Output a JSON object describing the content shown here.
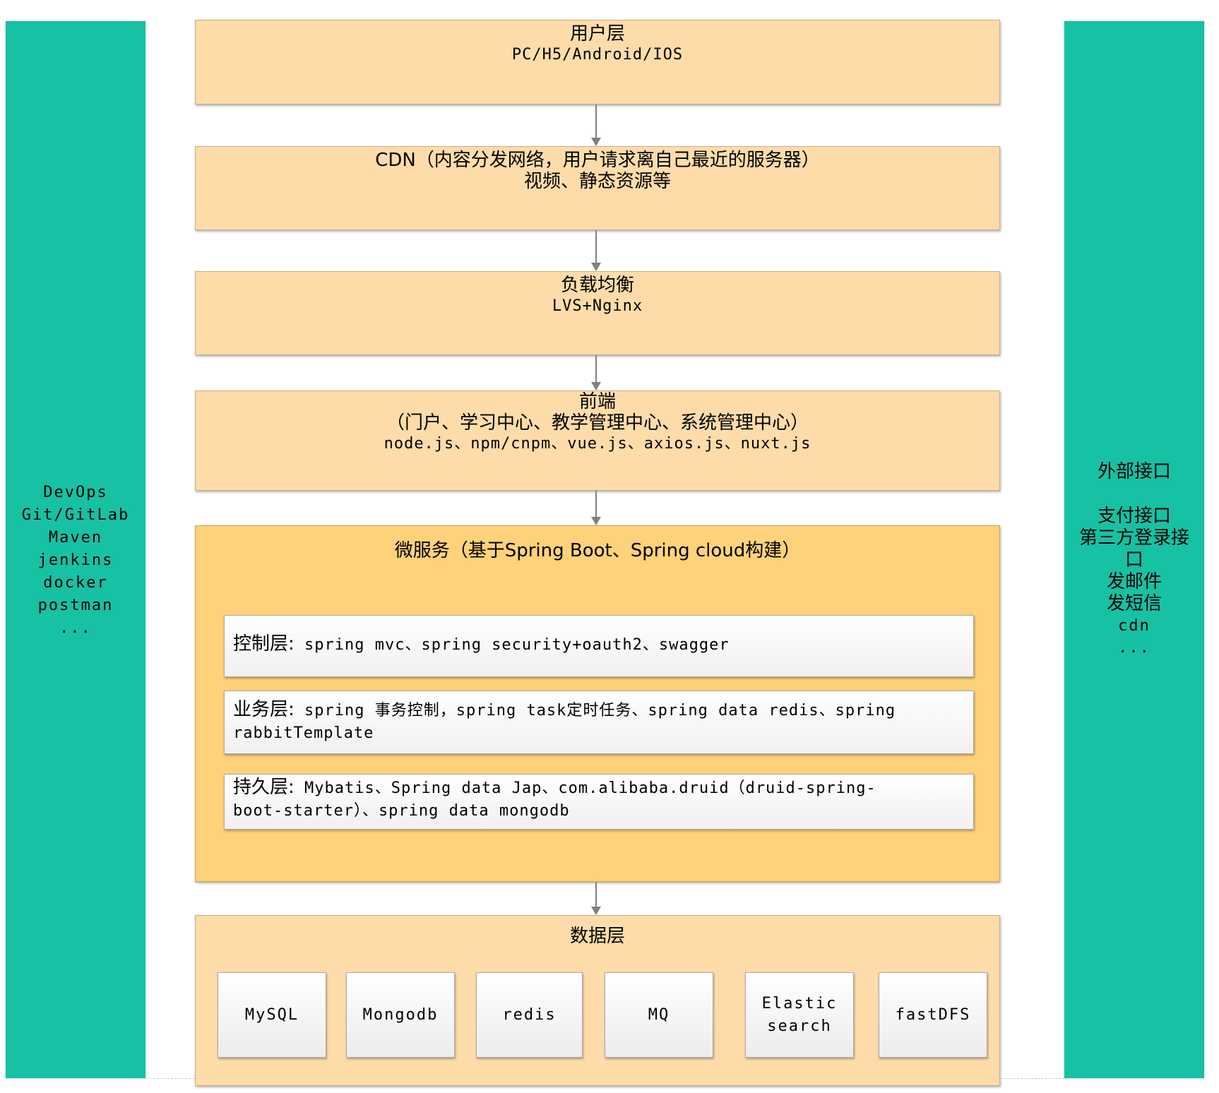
{
  "left_panel": {
    "lines": [
      "DevOps",
      "Git/GitLab",
      "Maven",
      "jenkins",
      "docker",
      "postman",
      "..."
    ]
  },
  "right_panel": {
    "title": "外部接口",
    "lines": [
      "支付接口",
      "第三方登录接",
      "口",
      "发邮件",
      "发短信",
      "cdn",
      "..."
    ]
  },
  "layers": {
    "user": {
      "title": "用户层",
      "subtitle": "PC/H5/Android/IOS"
    },
    "cdn": {
      "title": "CDN（内容分发网络，用户请求离自己最近的服务器）",
      "subtitle": "视频、静态资源等"
    },
    "load_balance": {
      "title": "负载均衡",
      "subtitle": "LVS+Nginx"
    },
    "frontend": {
      "title": "前端",
      "subtitle": "（门户、学习中心、教学管理中心、系统管理中心）",
      "tech": "node.js、npm/cnpm、vue.js、axios.js、nuxt.js"
    },
    "microservice": {
      "title": "微服务（基于Spring Boot、Spring cloud构建）",
      "rows": [
        {
          "label": "控制层:",
          "line1": " spring mvc、spring security+oauth2、swagger",
          "line2": ""
        },
        {
          "label": "业务层:",
          "line1": " spring 事务控制，spring task定时任务、spring data redis、spring",
          "line2": "rabbitTemplate"
        },
        {
          "label": "持久层:",
          "line1": " Mybatis、Spring data Jap、com.alibaba.druid（druid-spring-",
          "line2": "boot-starter）、spring data mongodb"
        }
      ]
    },
    "data": {
      "title": "数据层",
      "stores": [
        {
          "line1": "MySQL",
          "line2": ""
        },
        {
          "line1": "Mongodb",
          "line2": ""
        },
        {
          "line1": "redis",
          "line2": ""
        },
        {
          "line1": "MQ",
          "line2": ""
        },
        {
          "line1": "Elastic",
          "line2": "search"
        },
        {
          "line1": "fastDFS",
          "line2": ""
        }
      ]
    }
  },
  "colors": {
    "side_panel": "#16c1a4",
    "layer_fill": "#fedcaa",
    "microservice_fill": "#fdd27a",
    "arrow": "#808080"
  }
}
